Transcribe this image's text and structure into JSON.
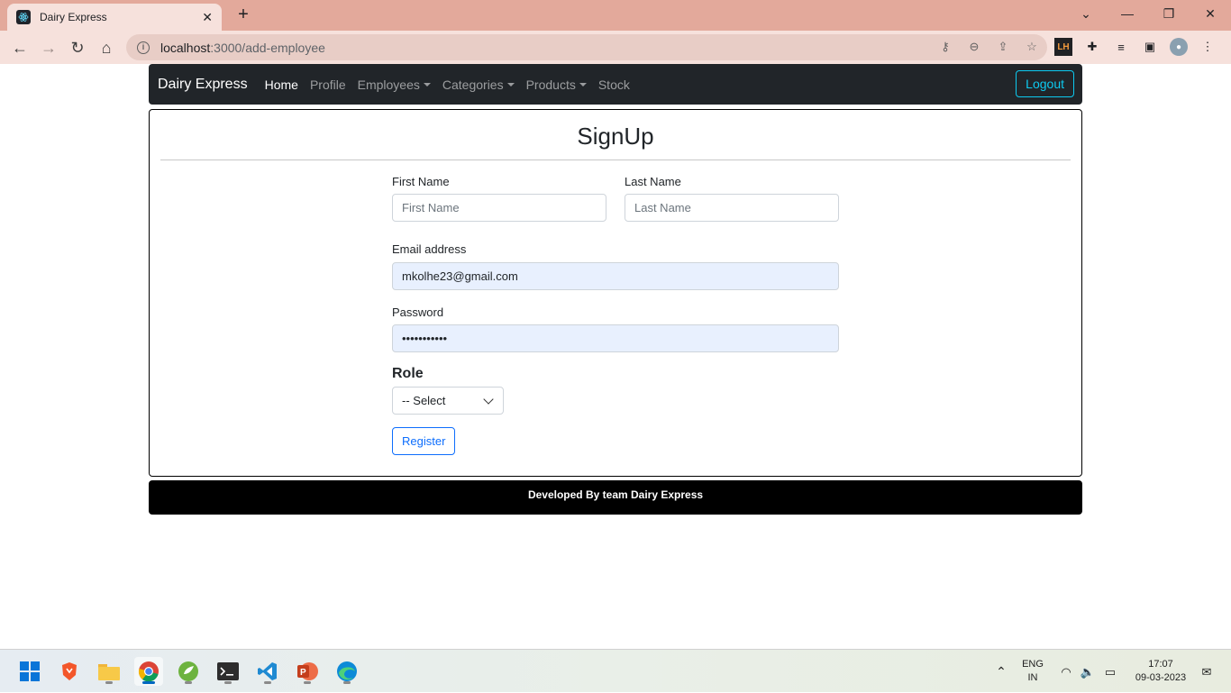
{
  "browser": {
    "tab_title": "Dairy Express",
    "url_host": "localhost",
    "url_path": ":3000/add-employee"
  },
  "navbar": {
    "brand": "Dairy Express",
    "links": [
      {
        "label": "Home"
      },
      {
        "label": "Profile"
      },
      {
        "label": "Employees"
      },
      {
        "label": "Categories"
      },
      {
        "label": "Products"
      },
      {
        "label": "Stock"
      }
    ],
    "logout_label": "Logout"
  },
  "form": {
    "title": "SignUp",
    "first_name_label": "First Name",
    "first_name_placeholder": "First Name",
    "last_name_label": "Last Name",
    "last_name_placeholder": "Last Name",
    "email_label": "Email address",
    "email_value": "mkolhe23@gmail.com",
    "password_label": "Password",
    "password_value": "•••••••••••",
    "role_label": "Role",
    "role_selected": "-- Select",
    "register_label": "Register"
  },
  "footer": {
    "text": "Developed By team Dairy Express"
  },
  "taskbar": {
    "lang_top": "ENG",
    "lang_bottom": "IN",
    "time": "17:07",
    "date": "09-03-2023"
  }
}
